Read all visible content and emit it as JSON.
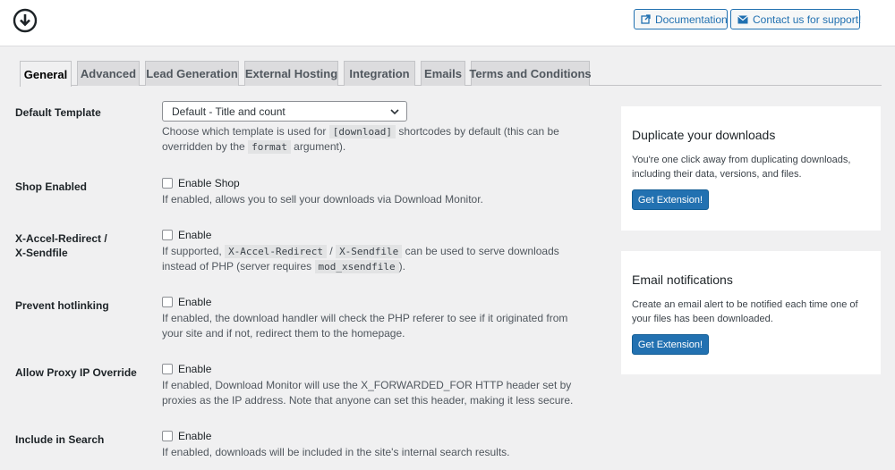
{
  "header": {
    "logo_icon": "download-circle-icon",
    "documentation_label": "Documentation",
    "contact_label": "Contact us for support!"
  },
  "tabs": [
    {
      "label": "General",
      "active": true
    },
    {
      "label": "Advanced",
      "active": false
    },
    {
      "label": "Lead Generation",
      "active": false
    },
    {
      "label": "External Hosting",
      "active": false
    },
    {
      "label": "Integration",
      "active": false
    },
    {
      "label": "Emails",
      "active": false
    },
    {
      "label": "Terms and Conditions",
      "active": false
    }
  ],
  "settings": {
    "default_template": {
      "label": "Default Template",
      "value": "Default - Title and count",
      "desc_1": "Choose which template is used for",
      "code_1": "[download]",
      "desc_2": "shortcodes by default (this can be",
      "desc_3": "overridden by the",
      "code_2": "format",
      "desc_4": "argument)."
    },
    "shop_enabled": {
      "label": "Shop Enabled",
      "checkbox_label": "Enable Shop",
      "checked": false,
      "desc": "If enabled, allows you to sell your downloads via Download Monitor."
    },
    "x_accel": {
      "label_1": "X-Accel-Redirect /",
      "label_2": "X-Sendfile",
      "checkbox_label": "Enable",
      "checked": false,
      "desc_1": "If supported,",
      "code_1": "X-Accel-Redirect",
      "sep": "/",
      "code_2": "X-Sendfile",
      "desc_2": "can be used to serve downloads",
      "desc_3": "instead of PHP (server requires",
      "code_3": "mod_xsendfile",
      "desc_4": ")."
    },
    "hotlinking": {
      "label": "Prevent hotlinking",
      "checkbox_label": "Enable",
      "checked": false,
      "desc_1": "If enabled, the download handler will check the PHP referer to see if it originated from",
      "desc_2": "your site and if not, redirect them to the homepage."
    },
    "proxy_ip": {
      "label": "Allow Proxy IP Override",
      "checkbox_label": "Enable",
      "checked": false,
      "desc_1": "If enabled, Download Monitor will use the X_FORWARDED_FOR HTTP header set by",
      "desc_2": "proxies as the IP address. Note that anyone can set this header, making it less secure."
    },
    "search": {
      "label": "Include in Search",
      "checkbox_label": "Enable",
      "checked": false,
      "desc": "If enabled, downloads will be included in the site's internal search results."
    }
  },
  "sidebar": {
    "cards": [
      {
        "title": "Duplicate your downloads",
        "text_1": "You're one click away from duplicating downloads,",
        "text_2": "including their data, versions, and files.",
        "button": "Get Extension!"
      },
      {
        "title": "Email notifications",
        "text_1": "Create an email alert to be notified each time one of",
        "text_2": "your files has been downloaded.",
        "button": "Get Extension!"
      }
    ]
  },
  "colors": {
    "accent": "#2271b1",
    "background": "#f0f0f1",
    "tab_inactive": "#dcdcde"
  }
}
